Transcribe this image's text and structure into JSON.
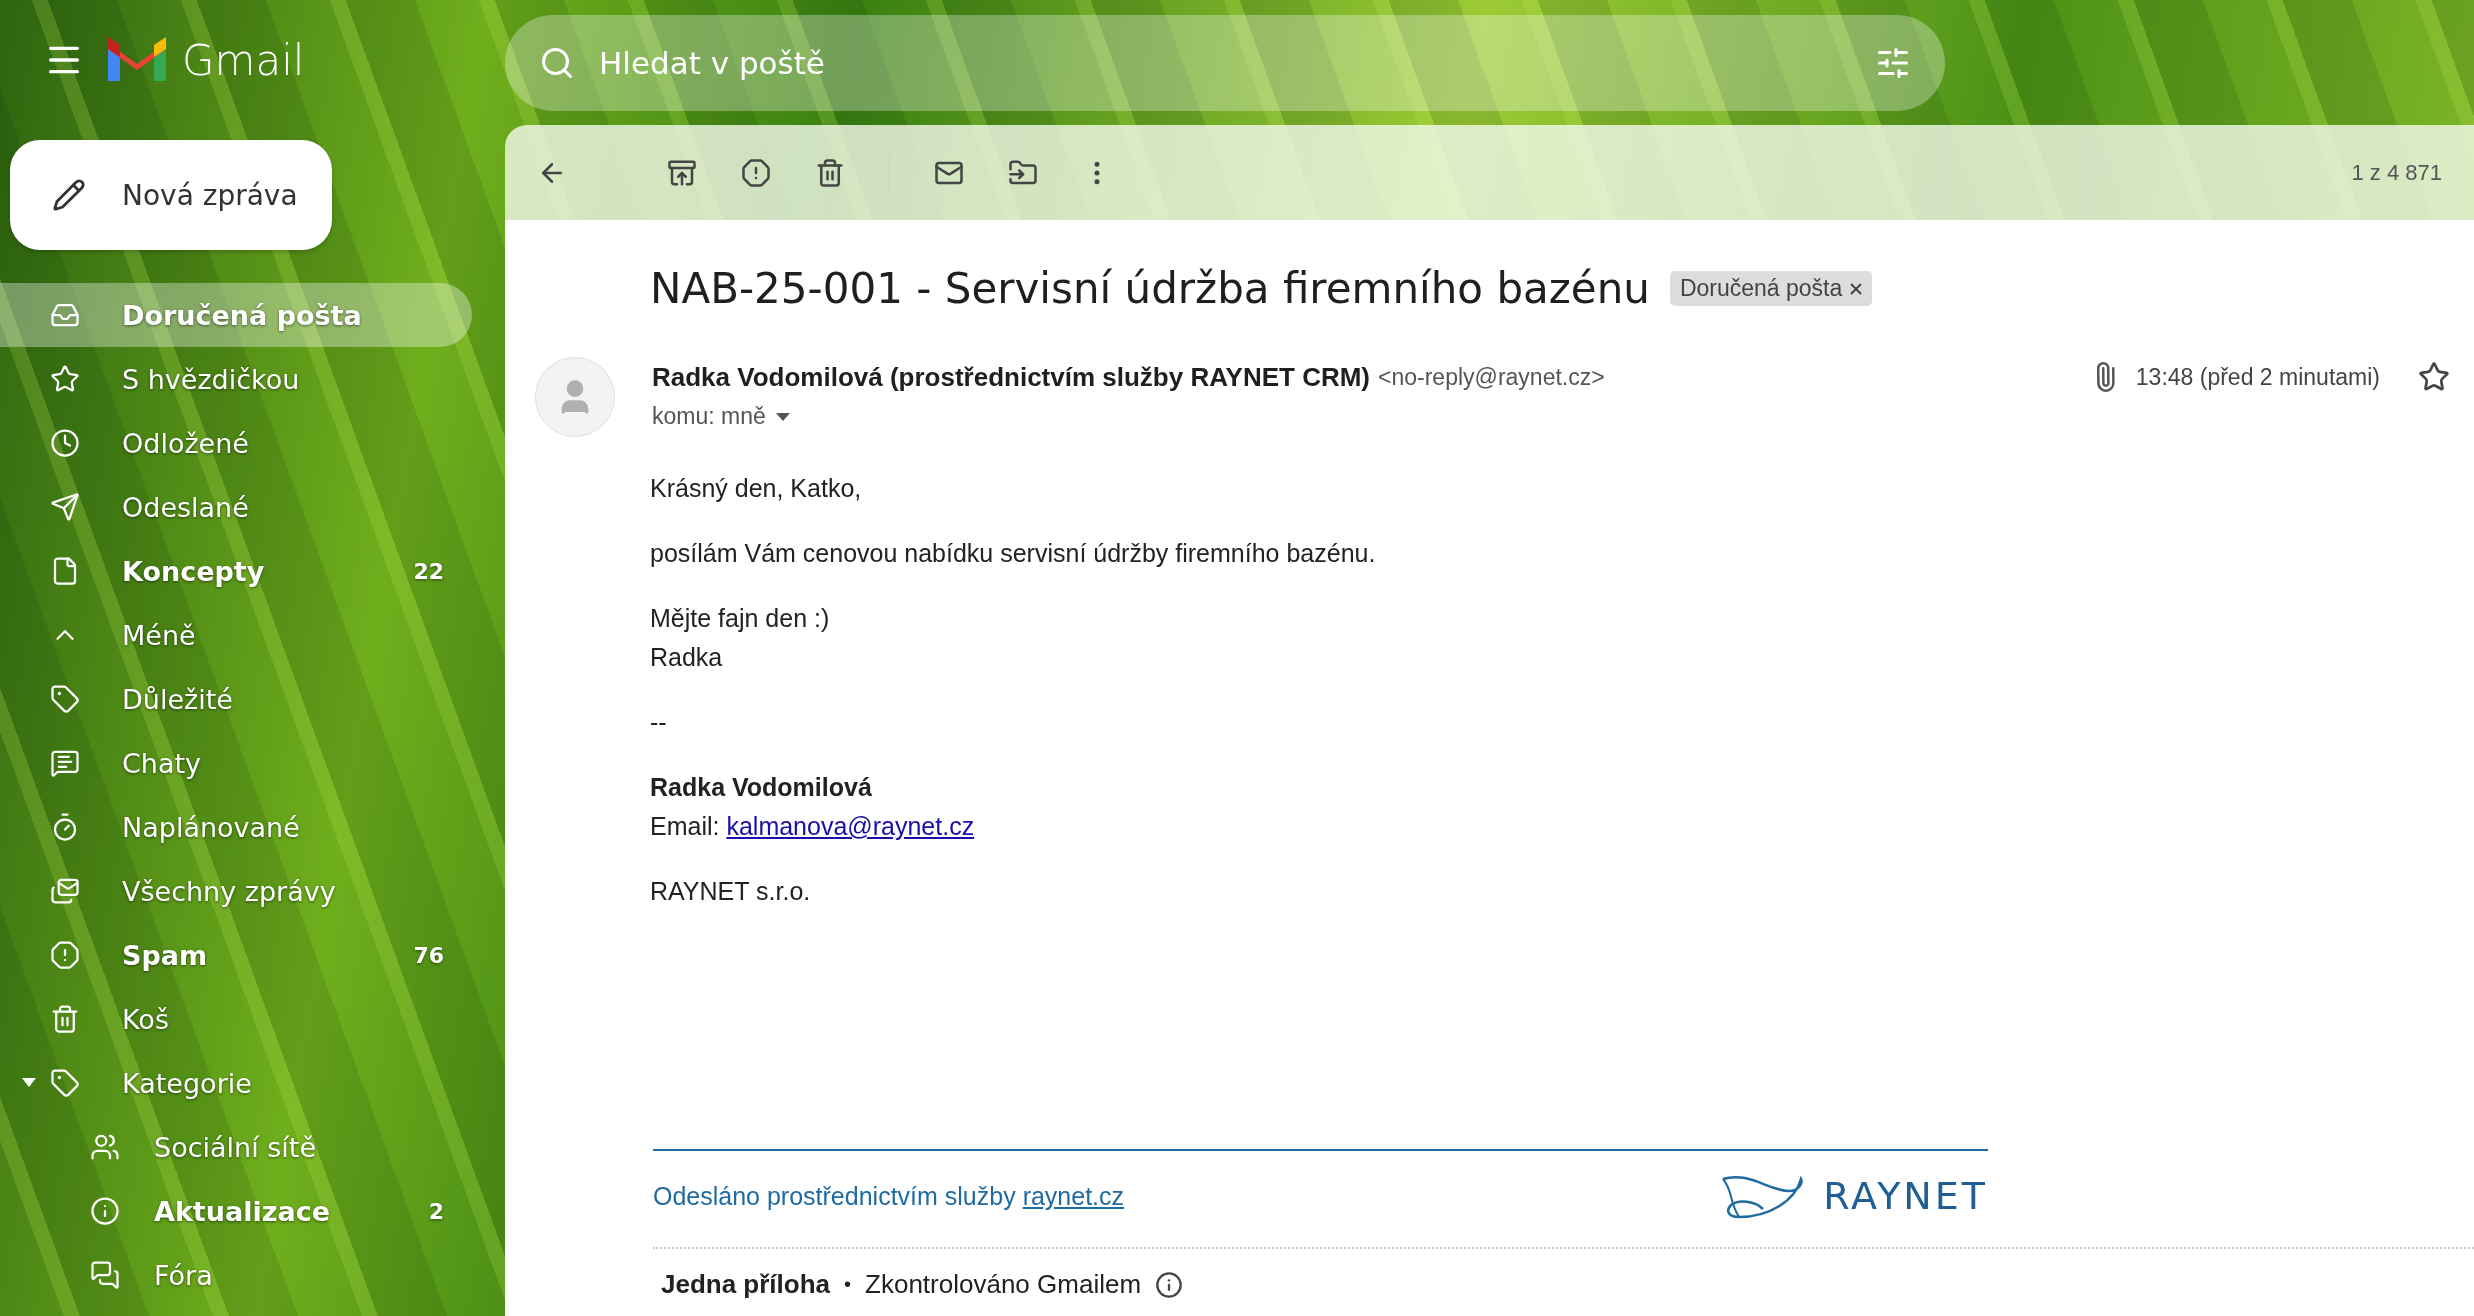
{
  "header": {
    "app_name": "Gmail",
    "search": {
      "placeholder": "Hledat v poště"
    }
  },
  "compose": {
    "label": "Nová zpráva"
  },
  "sidebar": {
    "items": [
      {
        "kind": "inbox",
        "label": "Doručená pošta",
        "bold": true,
        "selected": true
      },
      {
        "kind": "starred",
        "label": "S hvězdičkou",
        "bold": false,
        "selected": false
      },
      {
        "kind": "snoozed",
        "label": "Odložené",
        "bold": false,
        "selected": false
      },
      {
        "kind": "sent",
        "label": "Odeslané",
        "bold": false,
        "selected": false
      },
      {
        "kind": "drafts",
        "label": "Koncepty",
        "bold": true,
        "selected": false,
        "count": "22"
      },
      {
        "kind": "less",
        "label": "Méně",
        "bold": false,
        "selected": false
      },
      {
        "kind": "important",
        "label": "Důležité",
        "bold": false,
        "selected": false
      },
      {
        "kind": "chats",
        "label": "Chaty",
        "bold": false,
        "selected": false
      },
      {
        "kind": "scheduled",
        "label": "Naplánované",
        "bold": false,
        "selected": false
      },
      {
        "kind": "all",
        "label": "Všechny zprávy",
        "bold": false,
        "selected": false
      },
      {
        "kind": "spam",
        "label": "Spam",
        "bold": true,
        "selected": false,
        "count": "76"
      },
      {
        "kind": "trash",
        "label": "Koš",
        "bold": false,
        "selected": false
      },
      {
        "kind": "categories",
        "label": "Kategorie",
        "bold": false,
        "selected": false,
        "expanded": true,
        "children": [
          {
            "kind": "social",
            "label": "Sociální sítě",
            "bold": false,
            "selected": false
          },
          {
            "kind": "updates",
            "label": "Aktualizace",
            "bold": true,
            "selected": false,
            "count": "2"
          },
          {
            "kind": "forums",
            "label": "Fóra",
            "bold": false,
            "selected": false
          }
        ]
      }
    ]
  },
  "toolbar": {
    "counter": "1 z 4 871"
  },
  "message": {
    "subject": "NAB-25-001 - Servisní údržba firemního bazénu",
    "label_chip": "Doručená pošta",
    "sender_name": "Radka Vodomilová (prostřednictvím služby RAYNET CRM)",
    "sender_email": "<no-reply@raynet.cz>",
    "recipient": "komu: mně",
    "time": "13:48 (před 2 minutami)",
    "has_attachment": true,
    "starred": false,
    "body": [
      {
        "kind": "text",
        "lines": [
          "Krásný den, Katko,"
        ]
      },
      {
        "kind": "text",
        "lines": [
          "posílám Vám cenovou nabídku servisní údržby firemního bazénu."
        ]
      },
      {
        "kind": "text",
        "lines": [
          "Mějte fajn den :)",
          "Radka"
        ]
      },
      {
        "kind": "text",
        "lines": [
          "--"
        ]
      },
      {
        "kind": "signature",
        "name": "Radka Vodomilová",
        "email_label": "Email:",
        "email": "kalmanova@raynet.cz"
      },
      {
        "kind": "text",
        "lines": [
          "RAYNET s.r.o."
        ]
      }
    ],
    "footer": {
      "text": "Odesláno prostřednictvím služby",
      "link": "raynet.cz",
      "logo": "RAYNET"
    },
    "attachments": {
      "title": "Jedna příloha",
      "separator": "•",
      "scan_note": "Zkontrolováno Gmailem"
    }
  }
}
